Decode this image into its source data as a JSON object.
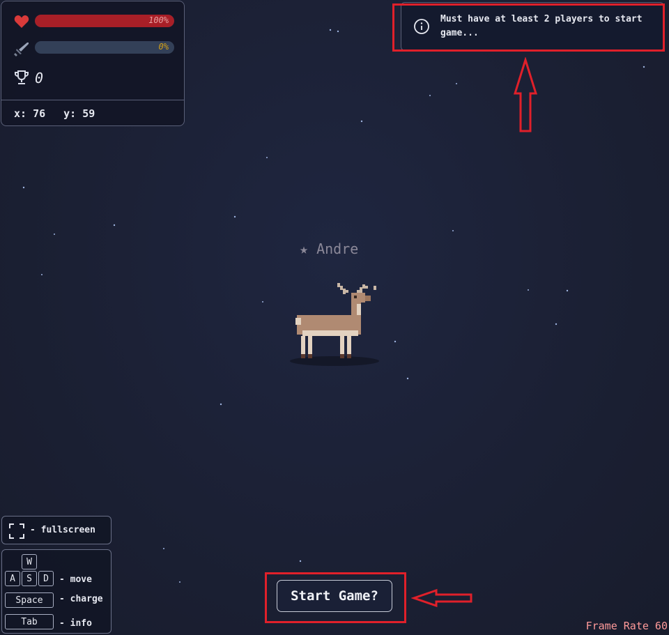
{
  "hud": {
    "health": {
      "percent_label": "100%",
      "fraction": 1.0,
      "color": "#a81f27"
    },
    "charge": {
      "percent_label": "0%",
      "fraction": 0.0,
      "color": "#d4a017"
    },
    "trophies": "0",
    "coords": {
      "x_label": "x: 76",
      "y_label": "y: 59"
    }
  },
  "toast": {
    "message": "Must have at least 2 players to start game..."
  },
  "player": {
    "name": "★ Andre"
  },
  "controls": {
    "fullscreen_label": "- fullscreen",
    "keys": {
      "w": "W",
      "a": "A",
      "s": "S",
      "d": "D",
      "space": "Space",
      "tab": "Tab"
    },
    "move_label": "- move",
    "charge_label": "- charge",
    "info_label": "- info"
  },
  "start_button": {
    "label": "Start Game?"
  },
  "frame_rate": "Frame Rate 60",
  "colors": {
    "highlight": "#e0202a",
    "background": "#1b2034"
  }
}
